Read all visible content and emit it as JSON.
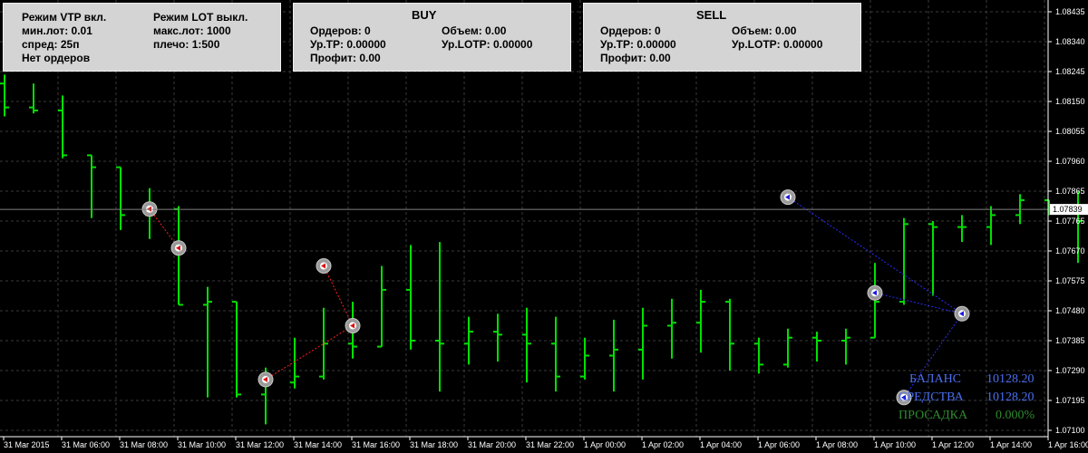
{
  "colors": {
    "background": "#000000",
    "grid": "#3a3a3a",
    "axis": "#ffffff",
    "bars": "#00e000",
    "current_price_line": "#808080",
    "buy_link": "#ff2020",
    "sell_link": "#2a2aff",
    "balance_text": "#4a6ff0",
    "equity_text": "#4a6ff0",
    "drawdown_text": "#2e8b2e"
  },
  "mode_panel": {
    "vtp_mode": "Режим VTP вкл.",
    "min_lot": "мин.лот:  0.01",
    "spread": "спред:  25п",
    "orders_status": "Нет ордеров",
    "lot_mode": "Режим LOT выкл.",
    "max_lot": "макс.лот:  1000",
    "leverage": "плечо:  1:500"
  },
  "buy_panel": {
    "title": "BUY",
    "orders": "Ордеров:  0",
    "volume": "Объем:  0.00",
    "tp_level": "Ур.TP:  0.00000",
    "lotp_level": "Ур.LOTP:  0.00000",
    "profit": "Профит:  0.00"
  },
  "sell_panel": {
    "title": "SELL",
    "orders": "Ордеров:  0",
    "volume": "Объем:  0.00",
    "tp_level": "Ур.TP:  0.00000",
    "lotp_level": "Ур.LOTP:  0.00000",
    "profit": "Профит:  0.00"
  },
  "account": {
    "balance_label": "БАЛАНС",
    "balance_value": "10128.20",
    "equity_label": "СРЕДСТВА",
    "equity_value": "10128.20",
    "drawdown_label": "ПРОСАДКА",
    "drawdown_value": "0.000%"
  },
  "chart_data": {
    "type": "ohlc",
    "current_price": 1.07839,
    "current_price_label": "1.07839",
    "y_range": [
      1.071,
      1.085
    ],
    "y_tick_labels": [
      "1.08435",
      "1.08340",
      "1.08245",
      "1.08150",
      "1.08055",
      "1.07960",
      "1.07865",
      "1.07765",
      "1.07670",
      "1.07575",
      "1.07480",
      "1.07385",
      "1.07290",
      "1.07195",
      "1.07100"
    ],
    "x_tick_labels": [
      "31 Mar 2015",
      "31 Mar 06:00",
      "31 Mar 08:00",
      "31 Mar 10:00",
      "31 Mar 12:00",
      "31 Mar 14:00",
      "31 Mar 16:00",
      "31 Mar 18:00",
      "31 Mar 20:00",
      "31 Mar 22:00",
      "1 Apr 00:00",
      "1 Apr 02:00",
      "1 Apr 04:00",
      "1 Apr 06:00",
      "1 Apr 08:00",
      "1 Apr 10:00",
      "1 Apr 12:00",
      "1 Apr 14:00",
      "1 Apr 16:00"
    ],
    "bars": [
      {
        "o": 1.0826,
        "h": 1.0829,
        "l": 1.0815,
        "c": 1.0818
      },
      {
        "o": 1.0818,
        "h": 1.0826,
        "l": 1.0816,
        "c": 1.0817
      },
      {
        "o": 1.0817,
        "h": 1.0822,
        "l": 1.0801,
        "c": 1.0802
      },
      {
        "o": 1.0802,
        "h": 1.0802,
        "l": 1.0781,
        "c": 1.0798
      },
      {
        "o": 1.0798,
        "h": 1.0798,
        "l": 1.0777,
        "c": 1.0782
      },
      {
        "o": 1.0782,
        "h": 1.0791,
        "l": 1.0774,
        "c": 1.0784
      },
      {
        "o": 1.0784,
        "h": 1.0785,
        "l": 1.0752,
        "c": 1.0752
      },
      {
        "o": 1.0752,
        "h": 1.0758,
        "l": 1.0721,
        "c": 1.0753
      },
      {
        "o": 1.0753,
        "h": 1.0753,
        "l": 1.0721,
        "c": 1.0722
      },
      {
        "o": 1.0722,
        "h": 1.0731,
        "l": 1.0712,
        "c": 1.0726
      },
      {
        "o": 1.0726,
        "h": 1.0741,
        "l": 1.0724,
        "c": 1.0728
      },
      {
        "o": 1.0728,
        "h": 1.0751,
        "l": 1.0727,
        "c": 1.0739
      },
      {
        "o": 1.0739,
        "h": 1.0753,
        "l": 1.0734,
        "c": 1.0738
      },
      {
        "o": 1.0738,
        "h": 1.0765,
        "l": 1.0738,
        "c": 1.0757
      },
      {
        "o": 1.0757,
        "h": 1.0772,
        "l": 1.0737,
        "c": 1.074
      },
      {
        "o": 1.074,
        "h": 1.0773,
        "l": 1.0723,
        "c": 1.0739
      },
      {
        "o": 1.0739,
        "h": 1.0748,
        "l": 1.0732,
        "c": 1.0743
      },
      {
        "o": 1.0743,
        "h": 1.0749,
        "l": 1.0733,
        "c": 1.0742
      },
      {
        "o": 1.0742,
        "h": 1.0751,
        "l": 1.0726,
        "c": 1.0739
      },
      {
        "o": 1.0739,
        "h": 1.0748,
        "l": 1.0723,
        "c": 1.0728
      },
      {
        "o": 1.0728,
        "h": 1.0741,
        "l": 1.0727,
        "c": 1.0735
      },
      {
        "o": 1.0735,
        "h": 1.0747,
        "l": 1.0723,
        "c": 1.0737
      },
      {
        "o": 1.0737,
        "h": 1.0751,
        "l": 1.0727,
        "c": 1.0745
      },
      {
        "o": 1.0745,
        "h": 1.0754,
        "l": 1.0734,
        "c": 1.0746
      },
      {
        "o": 1.0746,
        "h": 1.0757,
        "l": 1.0736,
        "c": 1.0753
      },
      {
        "o": 1.0753,
        "h": 1.0754,
        "l": 1.073,
        "c": 1.0739
      },
      {
        "o": 1.0739,
        "h": 1.0741,
        "l": 1.0729,
        "c": 1.0732
      },
      {
        "o": 1.0732,
        "h": 1.0744,
        "l": 1.0731,
        "c": 1.0741
      },
      {
        "o": 1.0741,
        "h": 1.0743,
        "l": 1.0733,
        "c": 1.074
      },
      {
        "o": 1.074,
        "h": 1.0744,
        "l": 1.0732,
        "c": 1.0741
      },
      {
        "o": 1.0741,
        "h": 1.0766,
        "l": 1.0741,
        "c": 1.0753
      },
      {
        "o": 1.0753,
        "h": 1.0781,
        "l": 1.0752,
        "c": 1.0779
      },
      {
        "o": 1.0779,
        "h": 1.078,
        "l": 1.0755,
        "c": 1.0778
      },
      {
        "o": 1.0778,
        "h": 1.0782,
        "l": 1.0773,
        "c": 1.0778
      },
      {
        "o": 1.0778,
        "h": 1.0785,
        "l": 1.0772,
        "c": 1.0782
      },
      {
        "o": 1.0782,
        "h": 1.0789,
        "l": 1.0779,
        "c": 1.0787
      },
      {
        "o": 1.0787,
        "h": 1.0787,
        "l": 1.0782,
        "c": 1.0784
      },
      {
        "o": 1.0784,
        "h": 1.079,
        "l": 1.0766,
        "c": 1.078
      },
      {
        "o": 1.078,
        "h": 1.0786,
        "l": 1.0757,
        "c": 1.0762
      },
      {
        "o": 1.0762,
        "h": 1.0768,
        "l": 1.0752,
        "c": 1.076
      },
      {
        "o": 1.076,
        "h": 1.0766,
        "l": 1.0717,
        "c": 1.0728
      },
      {
        "o": 1.0728,
        "h": 1.074,
        "l": 1.0723,
        "c": 1.0731
      },
      {
        "o": 1.0731,
        "h": 1.0755,
        "l": 1.0734,
        "c": 1.0737
      },
      {
        "o": 1.0737,
        "h": 1.0766,
        "l": 1.0736,
        "c": 1.0758
      },
      {
        "o": 1.0758,
        "h": 1.0762,
        "l": 1.0746,
        "c": 1.0747
      },
      {
        "o": 1.0747,
        "h": 1.0804,
        "l": 1.0747,
        "c": 1.0778
      },
      {
        "o": 1.0778,
        "h": 1.0777,
        "l": 1.0708,
        "c": 1.0777
      }
    ],
    "markers": [
      {
        "bar": 5,
        "price": 1.0784,
        "dir": "buy"
      },
      {
        "bar": 6,
        "price": 1.0771,
        "dir": "buy"
      },
      {
        "bar": 9,
        "price": 1.0727,
        "dir": "buy"
      },
      {
        "bar": 11,
        "price": 1.0765,
        "dir": "buy"
      },
      {
        "bar": 12,
        "price": 1.0745,
        "dir": "buy"
      },
      {
        "bar": 27,
        "price": 1.0788,
        "dir": "sell"
      },
      {
        "bar": 30,
        "price": 1.0756,
        "dir": "sell"
      },
      {
        "bar": 31,
        "price": 1.0721,
        "dir": "sell"
      },
      {
        "bar": 33,
        "price": 1.0749,
        "dir": "sell"
      }
    ],
    "links": [
      {
        "from": 0,
        "to": 1,
        "color": "buy"
      },
      {
        "from": 2,
        "to": 4,
        "color": "buy"
      },
      {
        "from": 3,
        "to": 4,
        "color": "buy"
      },
      {
        "from": 5,
        "to": 8,
        "color": "sell"
      },
      {
        "from": 6,
        "to": 8,
        "color": "sell"
      },
      {
        "from": 7,
        "to": 8,
        "color": "sell"
      }
    ]
  }
}
